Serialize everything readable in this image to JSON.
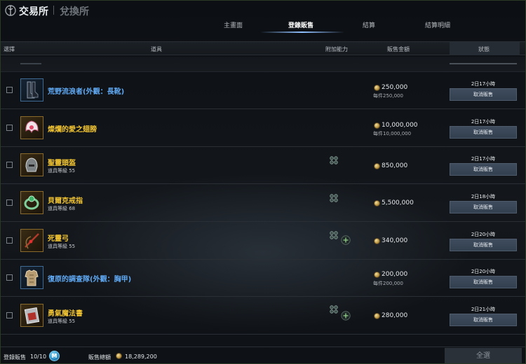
{
  "header": {
    "title": "交易所",
    "alt_title": "兌換所",
    "tabs": [
      {
        "label": "主畫面"
      },
      {
        "label": "登錄販售"
      },
      {
        "label": "結算"
      },
      {
        "label": "結算明細"
      }
    ],
    "active_tab": "登錄販售"
  },
  "columns": {
    "select": "選擇",
    "item": "道具",
    "option": "附加能力",
    "price": "販售金額",
    "status": "狀態"
  },
  "items": [
    {
      "name": "荒野流浪者(外觀：長靴)",
      "grade": "blue",
      "level": "",
      "price": "250,000",
      "unit_price": "每件250,000",
      "time": "2日17小時",
      "cancel": "取消販售",
      "icon": "boots-icon",
      "options": []
    },
    {
      "name": "燦爛的愛之翅膀",
      "grade": "gold",
      "level": "",
      "price": "10,000,000",
      "unit_price": "每件10,000,000",
      "time": "2日17小時",
      "cancel": "取消販售",
      "icon": "wings-icon",
      "options": []
    },
    {
      "name": "聖靈頭盔",
      "grade": "gold",
      "level": "道具等級 55",
      "price": "850,000",
      "unit_price": "",
      "time": "2日17小時",
      "cancel": "取消販售",
      "icon": "helmet-icon",
      "options": [
        "socket-icon"
      ]
    },
    {
      "name": "貝爾克戒指",
      "grade": "gold",
      "level": "道具等級 68",
      "price": "5,500,000",
      "unit_price": "",
      "time": "2日18小時",
      "cancel": "取消販售",
      "icon": "ring-icon",
      "options": [
        "socket-icon"
      ]
    },
    {
      "name": "死靈弓",
      "grade": "gold",
      "level": "道具等級 55",
      "price": "340,000",
      "unit_price": "",
      "time": "2日20小時",
      "cancel": "取消販售",
      "icon": "bow-icon",
      "options": [
        "socket-icon",
        "plus-icon"
      ]
    },
    {
      "name": "復原的調查隊(外觀：胸甲)",
      "grade": "blue",
      "level": "",
      "price": "200,000",
      "unit_price": "每件200,000",
      "time": "2日20小時",
      "cancel": "取消販售",
      "icon": "armor-icon",
      "options": []
    },
    {
      "name": "勇氣魔法書",
      "grade": "gold",
      "level": "道具等級 55",
      "price": "280,000",
      "unit_price": "",
      "time": "2日21小時",
      "cancel": "取消販售",
      "icon": "spellbook-icon",
      "options": [
        "socket-icon",
        "plus-icon"
      ]
    }
  ],
  "footer": {
    "count_label": "登錄販售",
    "count": "10/10",
    "membership_badge": "M",
    "total_label": "販售總額",
    "total": "18,289,200",
    "select_all": "全選"
  },
  "colors": {
    "gold_name": "#f2c431",
    "blue_name": "#5fa8f2",
    "cancel_button": "#3e4c5e",
    "active_tab_underline": "#8fc0ff"
  }
}
